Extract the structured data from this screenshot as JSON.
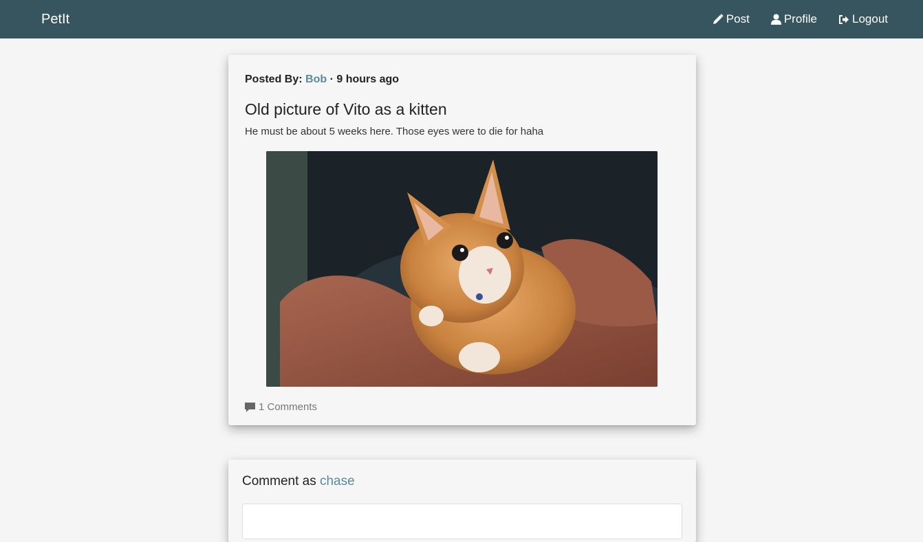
{
  "navbar": {
    "brand": "PetIt",
    "links": [
      {
        "label": "Post",
        "icon": "pencil-icon"
      },
      {
        "label": "Profile",
        "icon": "user-icon"
      },
      {
        "label": "Logout",
        "icon": "logout-icon"
      }
    ],
    "background": "#37555f"
  },
  "post": {
    "posted_by_label": "Posted By:",
    "author": "Bob",
    "separator": "·",
    "time_ago": "9 hours ago",
    "title": "Old picture of Vito as a kitten",
    "body": "He must be about 5 weeks here. Those eyes were to die for haha",
    "image_alt": "orange kitten held in arms",
    "comments_label": "1 Comments",
    "comments_icon": "comment-icon"
  },
  "comment_form": {
    "label": "Comment as",
    "username": "chase"
  },
  "colors": {
    "accent": "#5c8a9c",
    "page_bg": "#f5f5f5"
  }
}
